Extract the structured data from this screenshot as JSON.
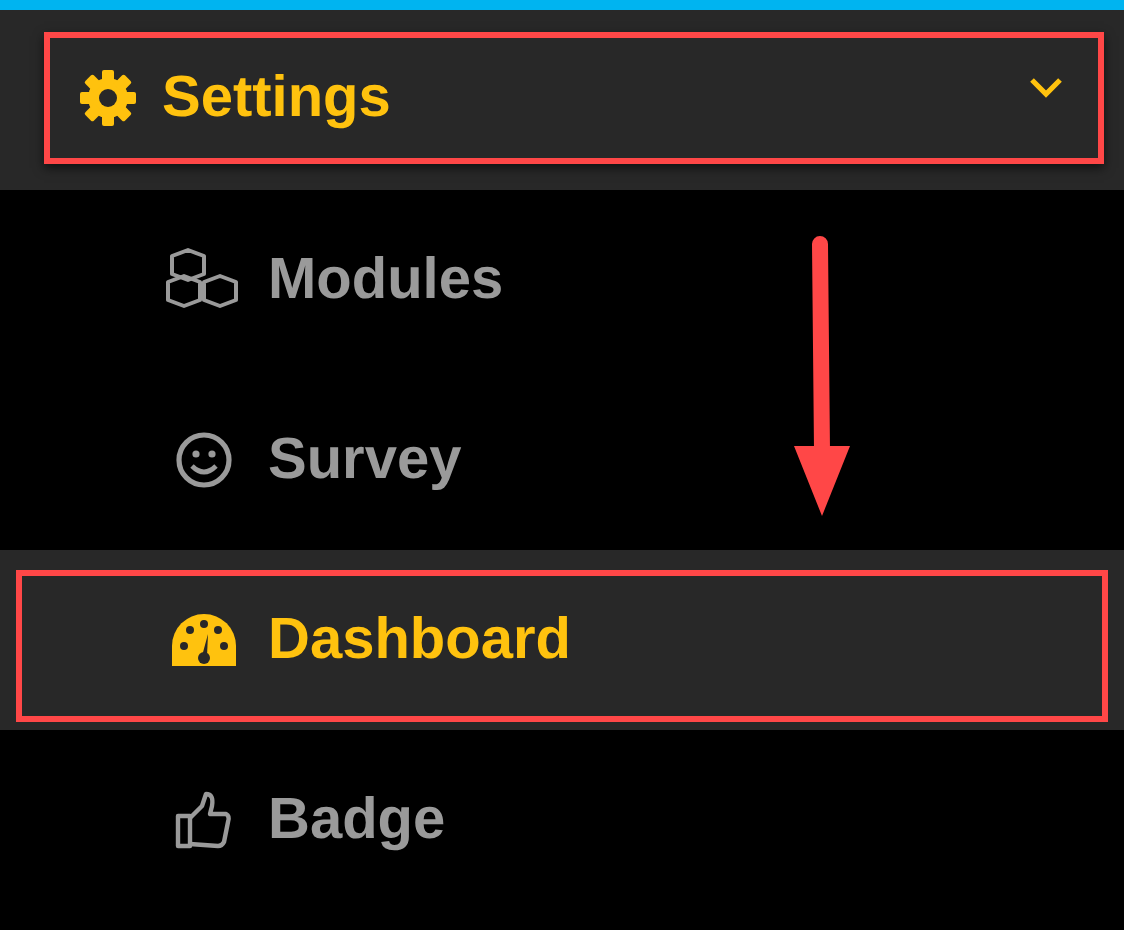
{
  "header": {
    "label": "Settings",
    "expanded": true,
    "highlighted": true
  },
  "items": [
    {
      "label": "Modules",
      "selected": false,
      "highlighted": false
    },
    {
      "label": "Survey",
      "selected": false,
      "highlighted": false
    },
    {
      "label": "Dashboard",
      "selected": true,
      "highlighted": true
    },
    {
      "label": "Badge",
      "selected": false,
      "highlighted": false
    }
  ]
}
